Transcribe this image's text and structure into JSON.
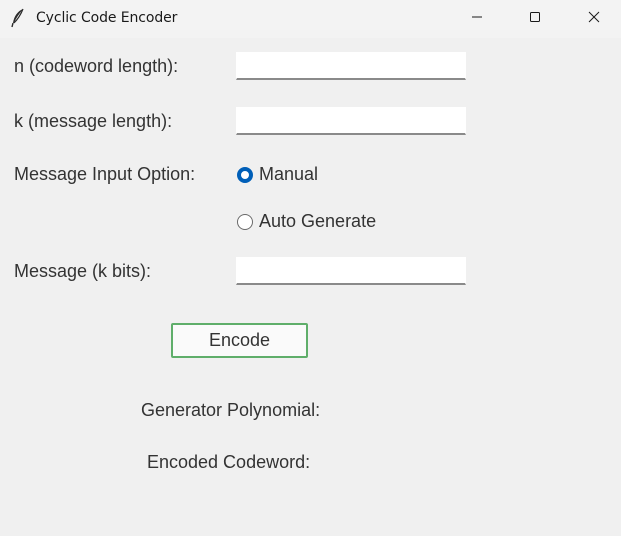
{
  "window": {
    "title": "Cyclic Code Encoder",
    "controls": [
      "minimize-icon",
      "maximize-icon",
      "close-icon"
    ]
  },
  "form": {
    "n_label": "n (codeword length):",
    "n_value": "",
    "k_label": "k (message length):",
    "k_value": "",
    "option_label": "Message Input Option:",
    "options": [
      {
        "label": "Manual",
        "selected": true
      },
      {
        "label": "Auto Generate",
        "selected": false
      }
    ],
    "message_label": "Message (k bits):",
    "message_value": "",
    "encode_label": "Encode"
  },
  "results": {
    "generator_label": "Generator Polynomial:",
    "codeword_label": "Encoded Codeword:"
  },
  "colors": {
    "background": "#f0f0f0",
    "radio_accent": "#005fb8",
    "button_border": "#5fae6a"
  }
}
